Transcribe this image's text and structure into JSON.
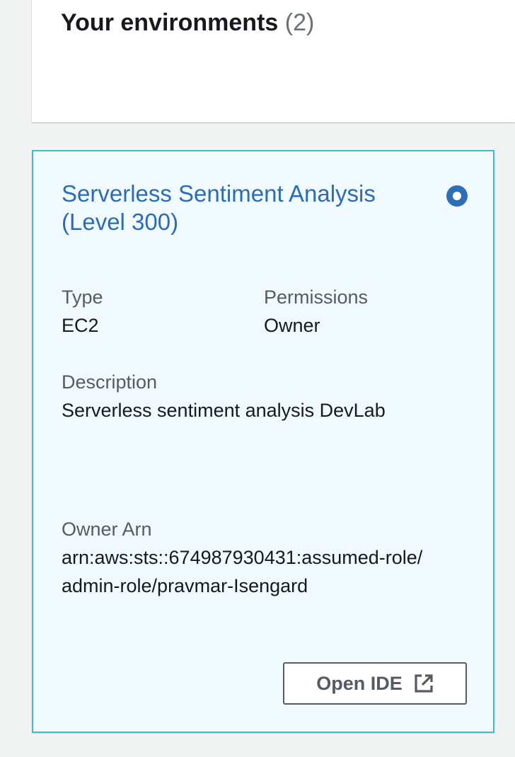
{
  "environments_panel": {
    "title": "Your environments",
    "count": "(2)"
  },
  "environment": {
    "name": "Serverless Sentiment Analysis (Level 300)",
    "selected": true,
    "type_label": "Type",
    "type_value": "EC2",
    "permissions_label": "Permissions",
    "permissions_value": "Owner",
    "description_label": "Description",
    "description_value": "Serverless sentiment analysis DevLab",
    "owner_arn_label": "Owner Arn",
    "owner_arn_value": "arn:aws:sts::674987930431:assumed-role/admin-role/pravmar-Isengard",
    "open_ide_label": "Open IDE",
    "open_ide_icon": "external-link-icon"
  },
  "colors": {
    "card_background": "#f1faff",
    "card_border": "#44b9d6",
    "link_blue": "#2b6cb5",
    "radio_blue": "#2d6fb7",
    "page_background": "#f2f3f3"
  }
}
